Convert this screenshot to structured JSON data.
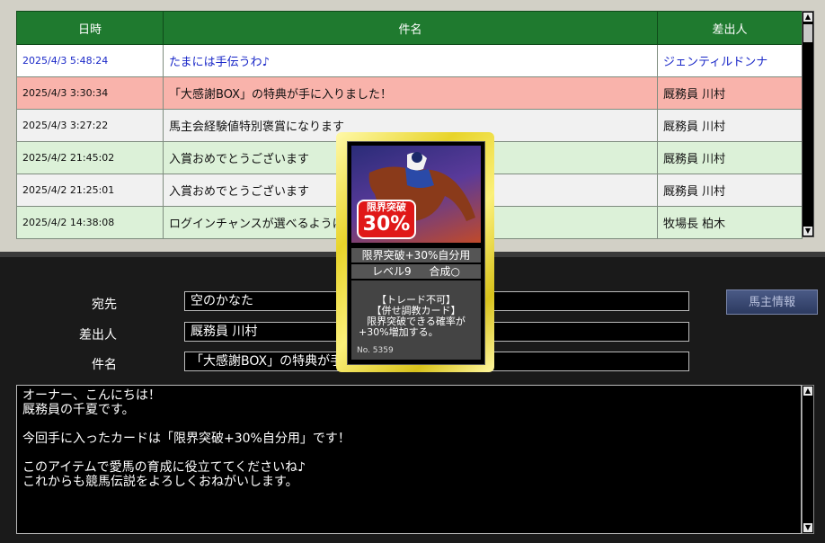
{
  "mail_list": {
    "headers": [
      "日時",
      "件名",
      "差出人"
    ],
    "rows": [
      {
        "date": "2025/4/3 5:48:24",
        "subject": "たまには手伝うわ♪",
        "sender": "ジェンティルドンナ"
      },
      {
        "date": "2025/4/3 3:30:34",
        "subject": "「大感謝BOX」の特典が手に入りました！",
        "sender": "厩務員 川村"
      },
      {
        "date": "2025/4/3 3:27:22",
        "subject": "馬主会経験値特別褒賞になります",
        "sender": "厩務員 川村"
      },
      {
        "date": "2025/4/2 21:45:02",
        "subject": "入賞おめでとうございます",
        "sender": "厩務員 川村"
      },
      {
        "date": "2025/4/2 21:25:01",
        "subject": "入賞おめでとうございます",
        "sender": "厩務員 川村"
      },
      {
        "date": "2025/4/2 14:38:08",
        "subject": "ログインチャンスが選べるように",
        "sender": "牧場長 柏木"
      }
    ]
  },
  "message": {
    "to_label": "宛先",
    "to_value": "空のかなた",
    "from_label": "差出人",
    "from_value": "厩務員 川村",
    "subject_label": "件名",
    "subject_value": "「大感謝BOX」の特典が手に入りました！",
    "owner_info_button": "馬主情報",
    "body_lines": [
      "オーナー、こんにちは！",
      "厩務員の千夏です。",
      "",
      "今回手に入ったカードは「限界突破+30%自分用」です！",
      "",
      "このアイテムで愛馬の育成に役立ててくださいね♪",
      "これからも競馬伝説をよろしくおねがいします。"
    ]
  },
  "card": {
    "badge_top": "限界突破",
    "badge_big": "30%",
    "name": "限界突破+30%自分用",
    "level": "レベル9",
    "synth": "合成○",
    "desc_lines": [
      "【トレード不可】",
      "【併せ調教カード】",
      "限界突破できる確率が",
      "+30%増加する。"
    ],
    "number": "No. 5359"
  },
  "icons": {
    "scroll_up": "scroll-up-icon",
    "scroll_down": "scroll-down-icon"
  },
  "colors": {
    "header_green": "#1f7a2f",
    "unread_blue": "#1a28c8",
    "selected_pink": "#f9b3ab",
    "row_green": "#dcf1d8"
  }
}
